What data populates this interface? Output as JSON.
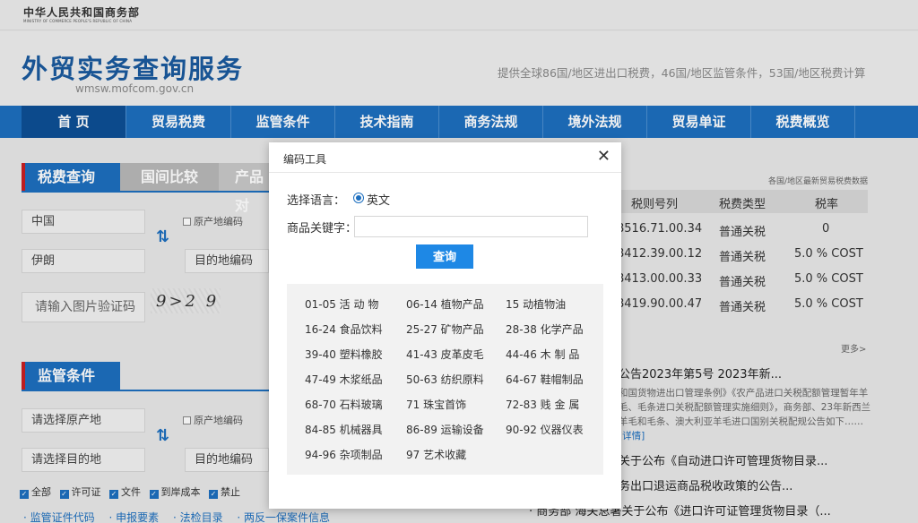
{
  "ministry": {
    "cn": "中华人民共和国商务部",
    "en": "MINISTRY OF COMMERCE PEOPLE'S REPUBLIC OF CHINA"
  },
  "site": {
    "title": "外贸实务查询服务",
    "domain": "wmsw.mofcom.gov.cn",
    "tagline": "提供全球86国/地区进出口税费，46国/地区监管条件，53国/地区税费计算"
  },
  "nav": [
    "首 页",
    "贸易税费",
    "监管条件",
    "技术指南",
    "商务法规",
    "境外法规",
    "贸易单证",
    "税费概览"
  ],
  "tax_query": {
    "tabs": [
      "税费查询",
      "国间比较",
      "产品对"
    ],
    "origin": "中国",
    "destination": "伊朗",
    "origin_code_label": "原产地编码",
    "destination_code_placeholder": "目的地编码",
    "captcha_placeholder": "请输入图片验证码",
    "captcha_text": "9>2 9"
  },
  "regulatory": {
    "title": "监管条件",
    "origin_placeholder": "请选择原产地",
    "destination_placeholder": "请选择目的地",
    "origin_code_label": "原产地编码",
    "destination_code_placeholder": "目的地编码",
    "filters": [
      "全部",
      "许可证",
      "文件",
      "到岸成本",
      "禁止"
    ],
    "links": [
      "· 监管证件代码",
      "· 申报要素",
      "· 法检目录",
      "· 两反一保案件信息"
    ]
  },
  "rates_table": {
    "caption": "各国/地区最新贸易税费数据",
    "headers": [
      "税则号列",
      "税费类型",
      "税率"
    ],
    "rows": [
      [
        "8516.71.00.34",
        "普通关税",
        "0"
      ],
      [
        "8412.39.00.12",
        "普通关税",
        "5.0 % COST"
      ],
      [
        "8413.00.00.33",
        "普通关税",
        "5.0 % COST"
      ],
      [
        "8419.90.00.47",
        "普通关税",
        "5.0 % COST"
      ]
    ],
    "more": "更多>"
  },
  "news": {
    "headline": "公告2023年第5号 2023年新...",
    "body": "和国货物进出口管理条例》《农产品进口关税配额管理暂年羊毛、毛条进口关税配额管理实施细则》，商务部、23年新西兰羊毛和毛条、澳大利亚羊毛进口国别关税配规公告如下……",
    "detail": "[详情]",
    "items": [
      "关于公布《自动进口许可管理货物目录...",
      "务出口退运商品税收政策的公告...",
      "· 商务部 海关总署关于公布《进口许可证管理货物目录（..."
    ]
  },
  "dialog": {
    "title": "编码工具",
    "lang_label": "选择语言：",
    "lang_option": "英文",
    "keyword_label": "商品关键字：",
    "keyword_value": "",
    "query_button": "查询",
    "categories": [
      [
        "01-05 活  动  物",
        "06-14 植物产品",
        "15      动植物油"
      ],
      [
        "16-24 食品饮料",
        "25-27 矿物产品",
        "28-38 化学产品"
      ],
      [
        "39-40 塑料橡胶",
        "41-43 皮革皮毛",
        "44-46 木  制  品"
      ],
      [
        "47-49 木浆纸品",
        "50-63 纺织原料",
        "64-67 鞋帽制品"
      ],
      [
        "68-70 石料玻璃",
        "71      珠宝首饰",
        "72-83 贱  金  属"
      ],
      [
        "84-85 机械器具",
        "86-89 运输设备",
        "90-92 仪器仪表"
      ],
      [
        "94-96 杂项制品",
        "97      艺术收藏"
      ]
    ]
  }
}
